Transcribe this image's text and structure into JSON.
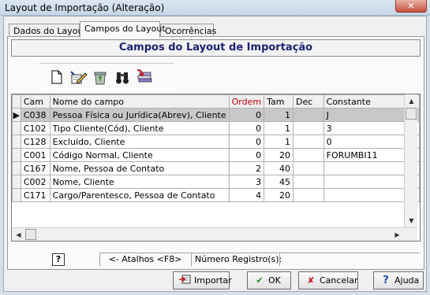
{
  "window": {
    "title": "Layout de Importação (Alteração)",
    "close_glyph": "✕"
  },
  "tabs": [
    {
      "label": "Dados do Layout"
    },
    {
      "label": "Campos do Layout"
    },
    {
      "label": "Ocorrências"
    }
  ],
  "panel": {
    "title": "Campos do Layout de Importação"
  },
  "toolbar": {
    "tools": [
      {
        "icon": "new-document-icon"
      },
      {
        "icon": "edit-pencil-icon"
      },
      {
        "icon": "recycle-bin-icon"
      },
      {
        "icon": "binoculars-icon"
      },
      {
        "icon": "import-stack-icon"
      }
    ]
  },
  "grid": {
    "columns": [
      "Cam",
      "Nome do campo",
      "Ordem",
      "Tam",
      "Dec",
      "Constante"
    ],
    "highlight_column": "Ordem",
    "current_row_marker": "▶",
    "rows": [
      {
        "cam": "C038",
        "nome": "Pessoa Física ou Jurídica(Abrev), Cliente",
        "ordem": "0",
        "tam": "1",
        "dec": "",
        "constante": "J"
      },
      {
        "cam": "C102",
        "nome": "Tipo Cliente(Cód), Cliente",
        "ordem": "0",
        "tam": "1",
        "dec": "",
        "constante": "3"
      },
      {
        "cam": "C128",
        "nome": "Excluído, Cliente",
        "ordem": "0",
        "tam": "1",
        "dec": "",
        "constante": "0"
      },
      {
        "cam": "C001",
        "nome": "Código Normal, Cliente",
        "ordem": "0",
        "tam": "20",
        "dec": "",
        "constante": "FORUMBI11"
      },
      {
        "cam": "C167",
        "nome": "Nome, Pessoa de Contato",
        "ordem": "2",
        "tam": "40",
        "dec": "",
        "constante": ""
      },
      {
        "cam": "C002",
        "nome": "Nome, Cliente",
        "ordem": "3",
        "tam": "45",
        "dec": "",
        "constante": ""
      },
      {
        "cam": "C171",
        "nome": "Cargo/Parentesco, Pessoa de Contato",
        "ordem": "4",
        "tam": "20",
        "dec": "",
        "constante": ""
      }
    ]
  },
  "statusbar": {
    "help_glyph": "?",
    "shortcuts": "<- Atalhos <F8>",
    "record_label": "Número Registro(s):"
  },
  "buttons": {
    "importar": {
      "label": "Importar",
      "icon": "import-icon"
    },
    "ok": {
      "label": "OK",
      "icon": "check-icon",
      "glyph": "✔",
      "color": "#1d8a1d"
    },
    "cancelar": {
      "label": "Cancelar",
      "icon": "cancel-icon",
      "glyph": "✘",
      "color": "#c81e1e"
    },
    "ajuda": {
      "label": "Ajuda",
      "icon": "help-icon",
      "glyph": "?",
      "color": "#1c4fb0"
    }
  }
}
